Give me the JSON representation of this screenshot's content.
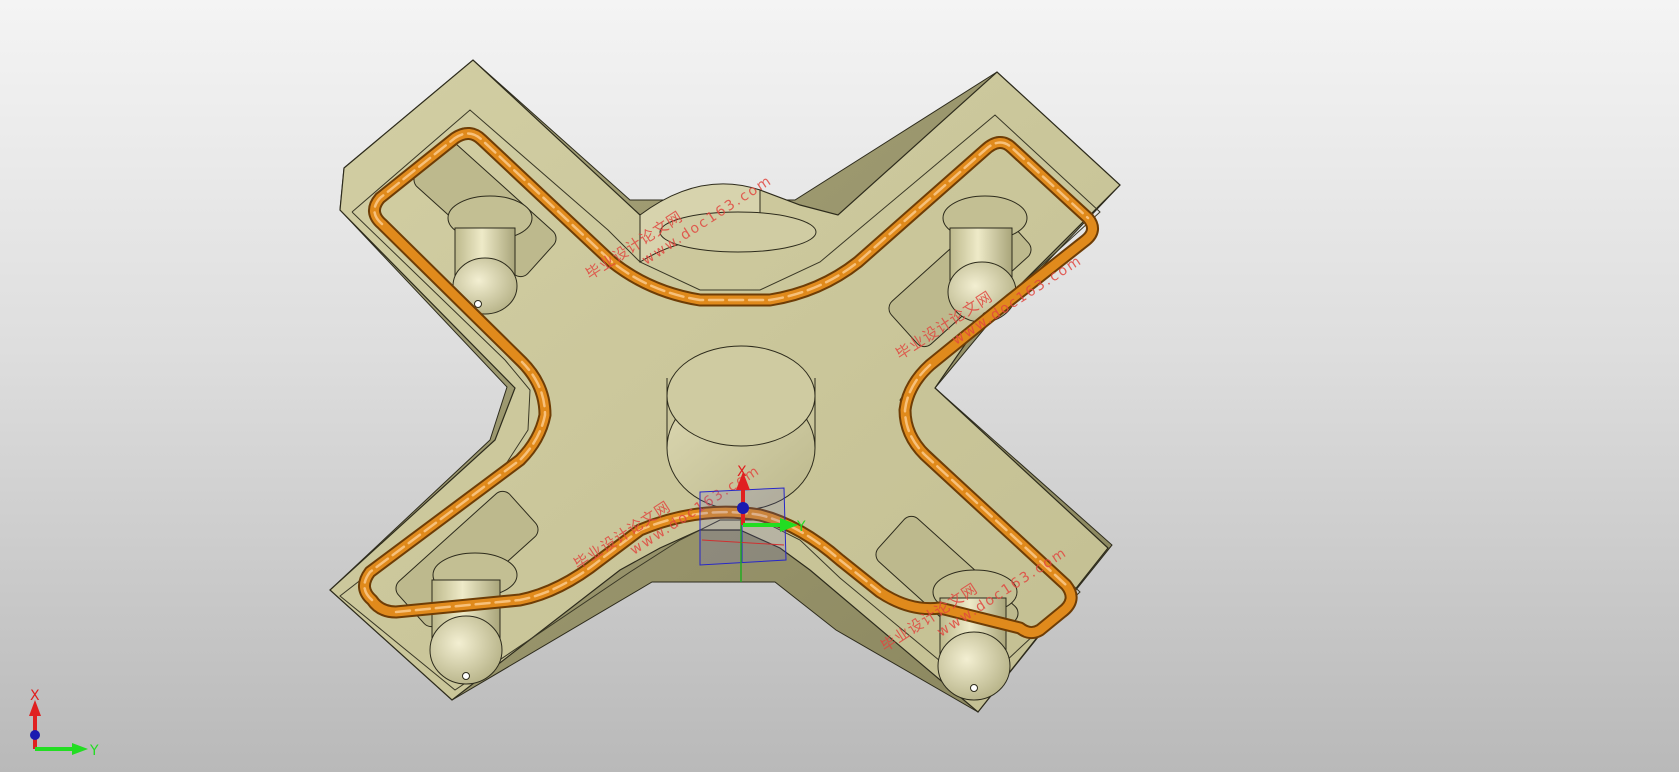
{
  "viewport": {
    "name": "3D part viewport",
    "colors": {
      "part_face": "#c9c59a",
      "part_shadow": "#8e8a62",
      "cooling_channel": "#e08a1c",
      "axis_x": "#e02020",
      "axis_y": "#22cc22",
      "axis_z": "#1818c0"
    }
  },
  "watermarks": [
    {
      "line1": "毕业设计论文网",
      "line2": "www.doc163.com"
    },
    {
      "line1": "毕业设计论文网",
      "line2": "www.doc163.com"
    },
    {
      "line1": "毕业设计论文网",
      "line2": "www.doc163.com"
    },
    {
      "line1": "毕业设计论文网",
      "line2": "www.doc163.com"
    }
  ],
  "manipulator": {
    "x_label": "X",
    "y_label": "Y"
  },
  "triad": {
    "x_label": "X",
    "y_label": "Y"
  }
}
